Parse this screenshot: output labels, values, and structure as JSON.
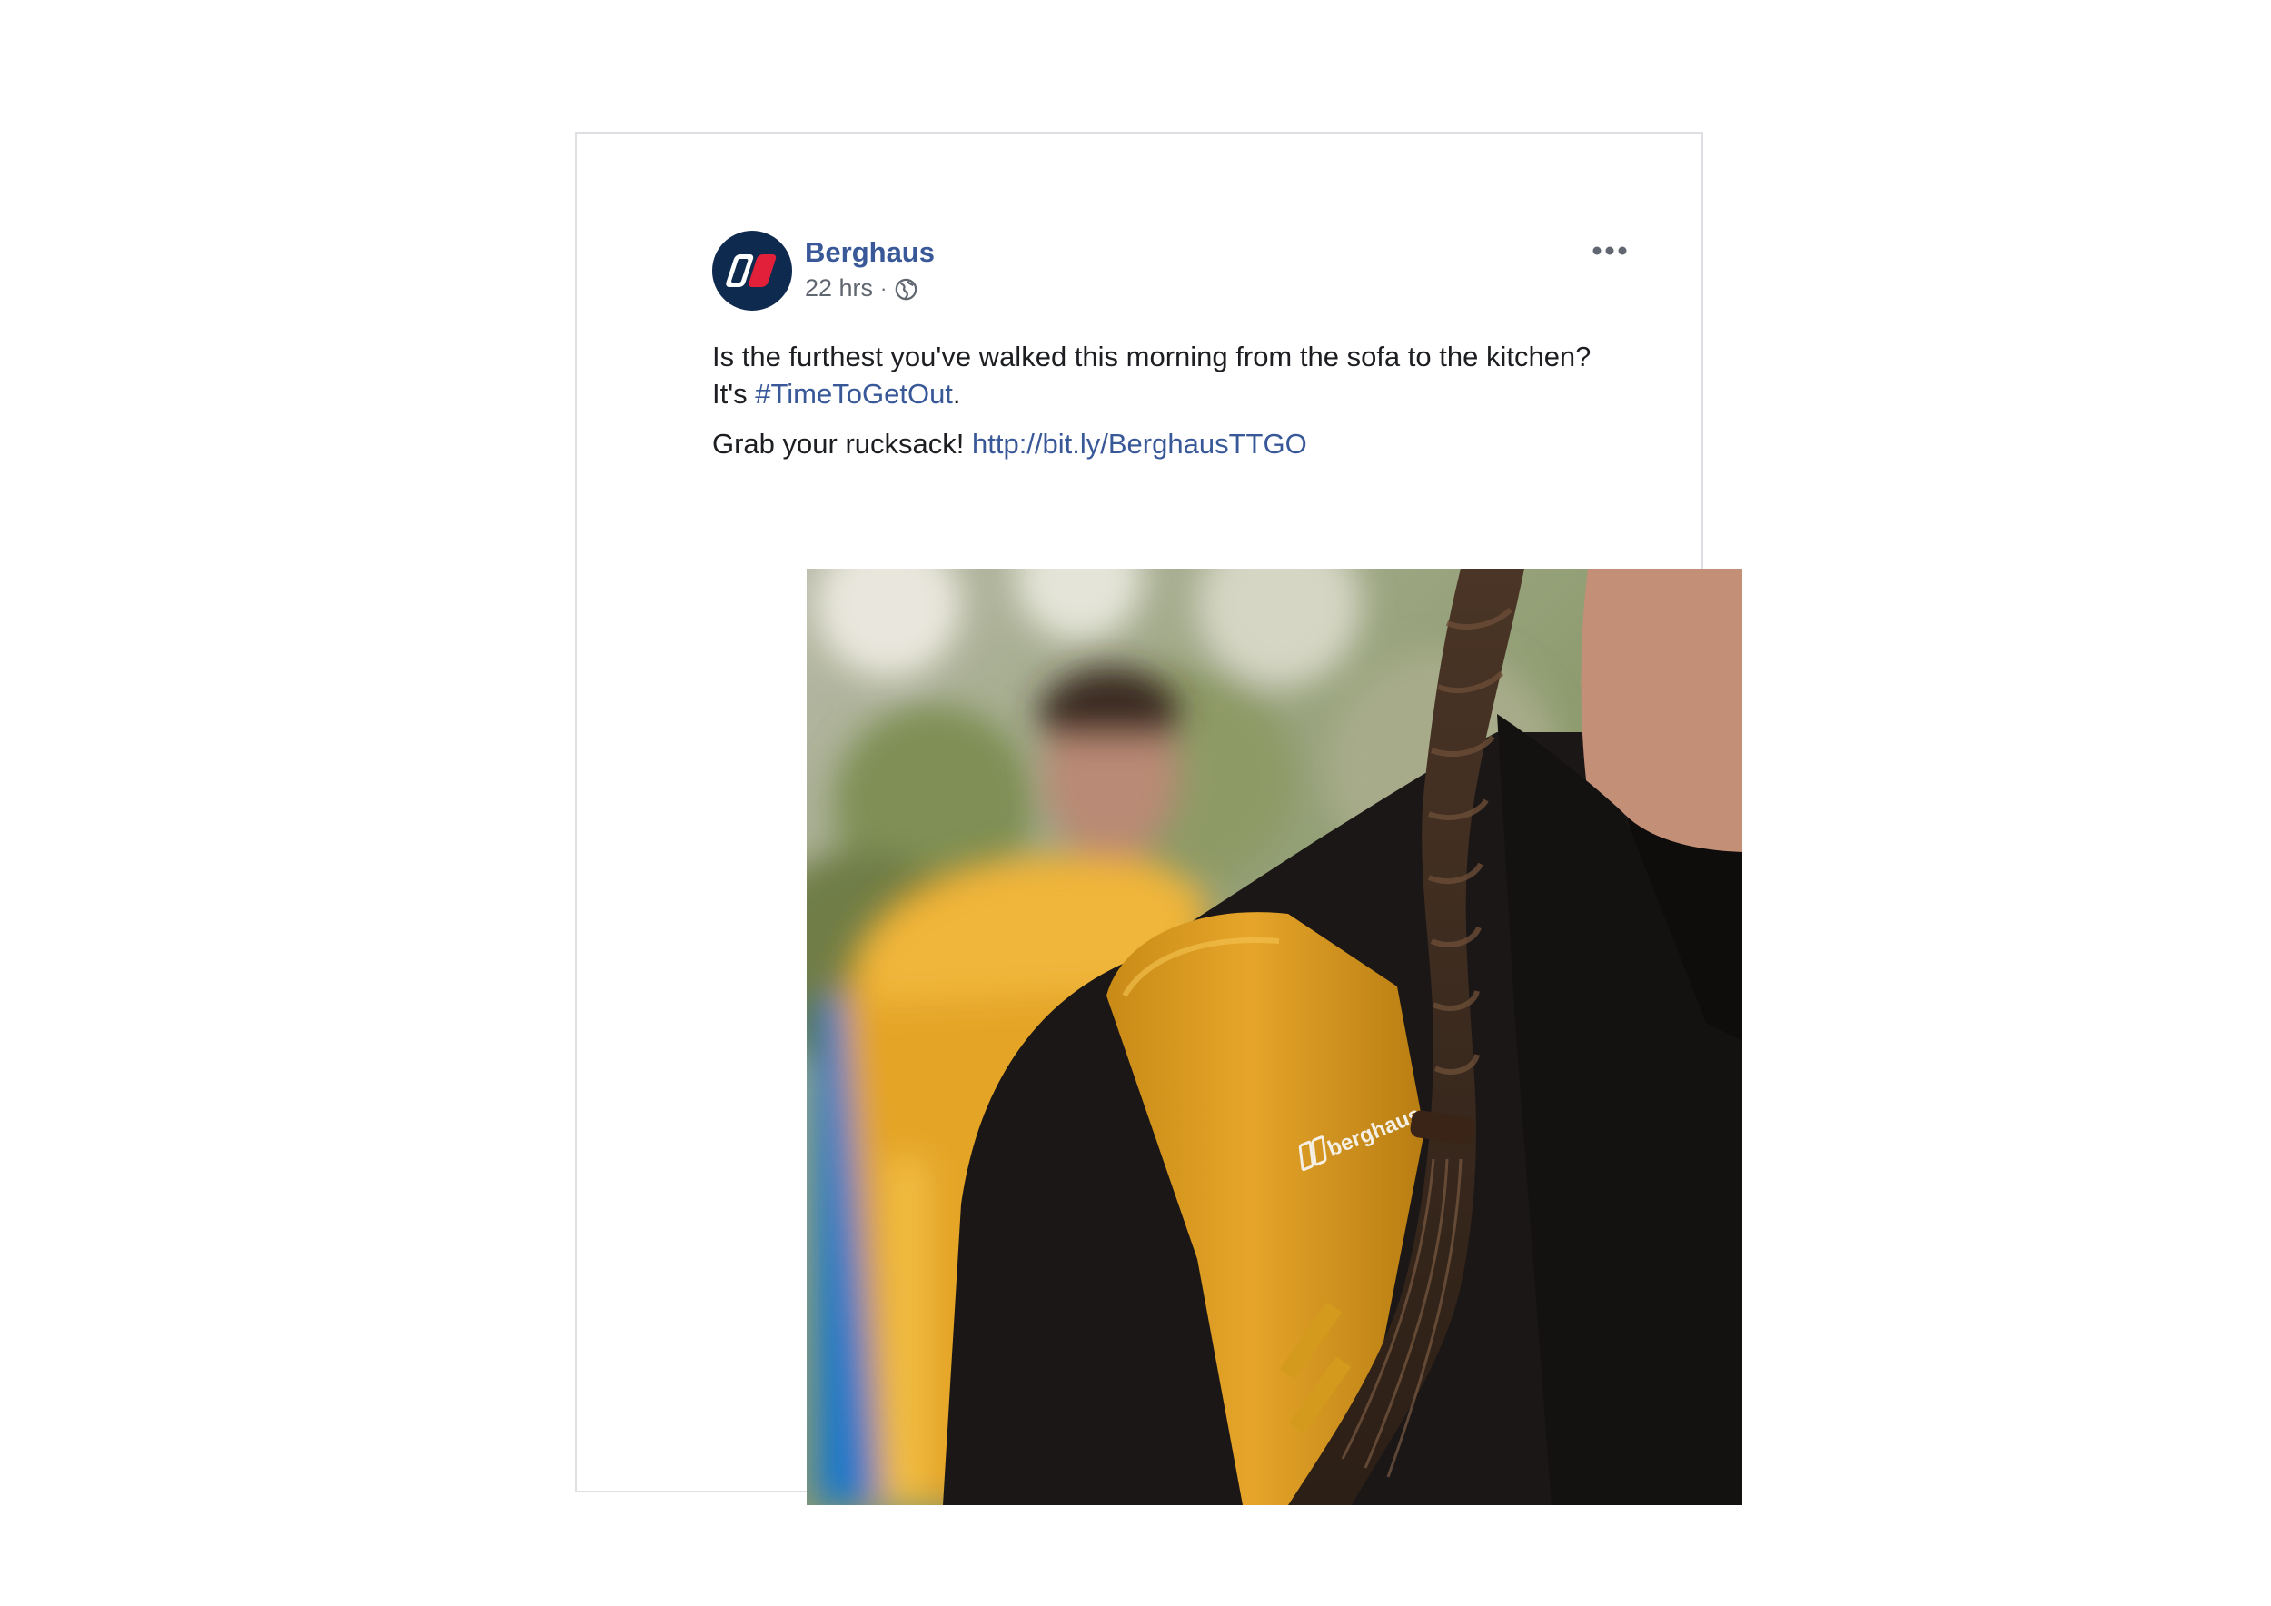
{
  "post": {
    "page_name": "Berghaus",
    "timestamp": "22 hrs",
    "separator": "·",
    "privacy_icon": "globe-icon",
    "more_icon": "more-options-icon",
    "text_line1_a": "Is the furthest you've walked this morning from the sofa to the kitchen? It's ",
    "hashtag": "#TimeToGetOut",
    "text_line1_b": ".",
    "text_line2_a": "Grab your rucksack! ",
    "url": "http://bit.ly/BerghausTTGO",
    "image_brand_text": "berghaus"
  },
  "colors": {
    "link": "#385898",
    "text": "#1c1e21",
    "secondary_text": "#606770",
    "logo_navy": "#0f2a4f",
    "logo_red": "#e2203a",
    "backpack_yellow": "#e3a324"
  }
}
